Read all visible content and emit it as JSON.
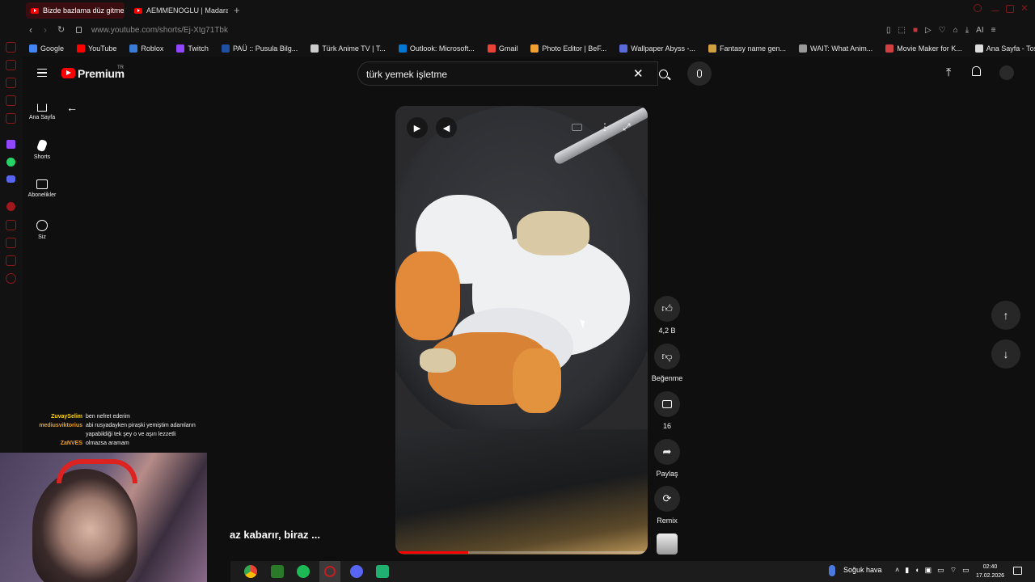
{
  "browser": {
    "tabs": [
      {
        "label": "Bizde bazlama düz gitmez"
      },
      {
        "label": "AEMMENOGLU | Madara C"
      }
    ],
    "url": "www.youtube.com/shorts/Ej-Xtg71Tbk",
    "bookmarks": [
      {
        "label": "Google",
        "color": "#4285f4"
      },
      {
        "label": "YouTube",
        "color": "#ff0000"
      },
      {
        "label": "Roblox",
        "color": "#3a7bd5"
      },
      {
        "label": "Twitch",
        "color": "#9146ff"
      },
      {
        "label": "PAÜ :: Pusula Bilg...",
        "color": "#1e4fa0"
      },
      {
        "label": "Türk Anime TV | T...",
        "color": "#cccccc"
      },
      {
        "label": "Outlook: Microsoft...",
        "color": "#0078d4"
      },
      {
        "label": "Gmail",
        "color": "#ea4335"
      },
      {
        "label": "Photo Editor | BeF...",
        "color": "#f0a030"
      },
      {
        "label": "Wallpaper Abyss -...",
        "color": "#5a6ad8"
      },
      {
        "label": "Fantasy name gen...",
        "color": "#d0a040"
      },
      {
        "label": "WAIT: What Anim...",
        "color": "#999999"
      },
      {
        "label": "Movie Maker for K...",
        "color": "#d04040"
      },
      {
        "label": "Ana Sayfa - Tospa...",
        "color": "#dddddd"
      }
    ]
  },
  "youtube": {
    "logo_text": "Premium",
    "logo_region": "TR",
    "search_value": "türk yemek işletme",
    "nav": [
      {
        "label": "Ana Sayfa"
      },
      {
        "label": "Shorts"
      },
      {
        "label": "Abonelikler"
      },
      {
        "label": "Siz"
      }
    ],
    "actions": {
      "like_count": "4,2 B",
      "dislike_label": "Beğenme",
      "comment_count": "16",
      "share_label": "Paylaş",
      "remix_label": "Remix"
    },
    "progress": 0.29
  },
  "stream": {
    "chat": [
      {
        "user": "ZuvaySelim",
        "color": "#f5d020",
        "message": "ben nefret ederim"
      },
      {
        "user": "mediusviktorius",
        "color": "#f0a020",
        "message": "abi rusyadayken pirașki yemiştim adamların"
      },
      {
        "user": "",
        "color": "#f0a020",
        "message": "yapabildiği tek şey o ve aşırı lezzetli"
      },
      {
        "user": "ZaNVES",
        "color": "#f5a020",
        "message": "olmazsa aramam"
      }
    ],
    "subtitle": "az kabarır, biraz ..."
  },
  "taskbar": {
    "weather": "Soğuk hava",
    "time": "02:40",
    "date": "17.02.2026"
  }
}
